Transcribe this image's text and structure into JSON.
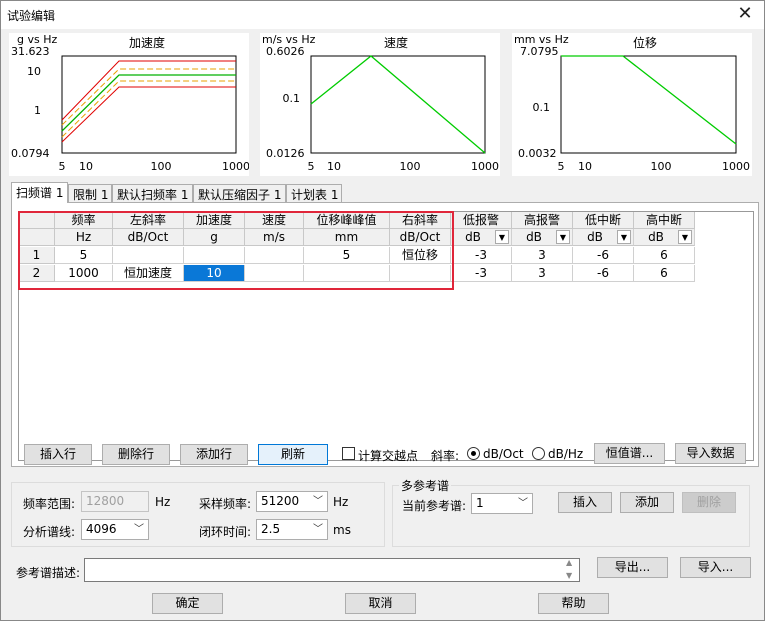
{
  "window": {
    "title": "试验编辑",
    "close_glyph": "✕"
  },
  "charts": {
    "accel": {
      "unit": "g vs Hz",
      "title": "加速度",
      "y_top": "31.623",
      "y_mid1": "10",
      "y_mid2": "1",
      "y_bot": "0.0794",
      "x_ticks": [
        "5",
        "10",
        "100",
        "1000"
      ]
    },
    "vel": {
      "unit": "m/s vs Hz",
      "title": "速度",
      "y_top": "0.6026",
      "y_mid": "0.1",
      "y_bot": "0.0126",
      "x_ticks": [
        "5",
        "10",
        "100",
        "1000"
      ]
    },
    "disp": {
      "unit": "mm vs Hz",
      "title": "位移",
      "y_top": "7.0795",
      "y_mid": "0.1",
      "y_bot": "0.0032",
      "x_ticks": [
        "5",
        "10",
        "100",
        "1000"
      ]
    }
  },
  "tabs": [
    "扫频谱 1",
    "限制 1",
    "默认扫频率 1",
    "默认压缩因子 1",
    "计划表 1"
  ],
  "table": {
    "headers": [
      "频率",
      "左斜率",
      "加速度",
      "速度",
      "位移峰峰值",
      "右斜率",
      "低报警",
      "高报警",
      "低中断",
      "高中断"
    ],
    "units": [
      "Hz",
      "dB/Oct",
      "g",
      "m/s",
      "mm",
      "dB/Oct"
    ],
    "unit_dd": [
      "dB",
      "dB",
      "dB",
      "dB"
    ],
    "rows": [
      {
        "num": "1",
        "cells": [
          "5",
          "",
          "",
          "",
          "5",
          "恒位移",
          "-3",
          "3",
          "-6",
          "6"
        ]
      },
      {
        "num": "2",
        "cells": [
          "1000",
          "恒加速度",
          "10",
          "",
          "",
          "",
          "-3",
          "3",
          "-6",
          "6"
        ]
      }
    ]
  },
  "buttons": {
    "insert_row": "插入行",
    "delete_row": "删除行",
    "add_row": "添加行",
    "refresh": "刷新",
    "calc_cross": "计算交越点",
    "slope_label": "斜率:",
    "slope_dboct": "dB/Oct",
    "slope_dbhz": "dB/Hz",
    "const_spec": "恒值谱...",
    "import_data": "导入数据"
  },
  "settings": {
    "freq_range_label": "频率范围:",
    "freq_range_value": "12800",
    "freq_unit": "Hz",
    "analysis_lines_label": "分析谱线:",
    "analysis_lines_value": "4096",
    "sample_rate_label": "采样频率:",
    "sample_rate_value": "51200",
    "sample_rate_unit": "Hz",
    "loop_time_label": "闭环时间:",
    "loop_time_value": "2.5",
    "loop_time_unit": "ms"
  },
  "multi_ref": {
    "title": "多参考谱",
    "current_label": "当前参考谱:",
    "current_value": "1",
    "insert": "插入",
    "add": "添加",
    "delete": "删除"
  },
  "ref_desc": {
    "label": "参考谱描述:",
    "value": "",
    "export": "导出...",
    "import": "导入..."
  },
  "footer": {
    "ok": "确定",
    "cancel": "取消",
    "help": "帮助"
  }
}
